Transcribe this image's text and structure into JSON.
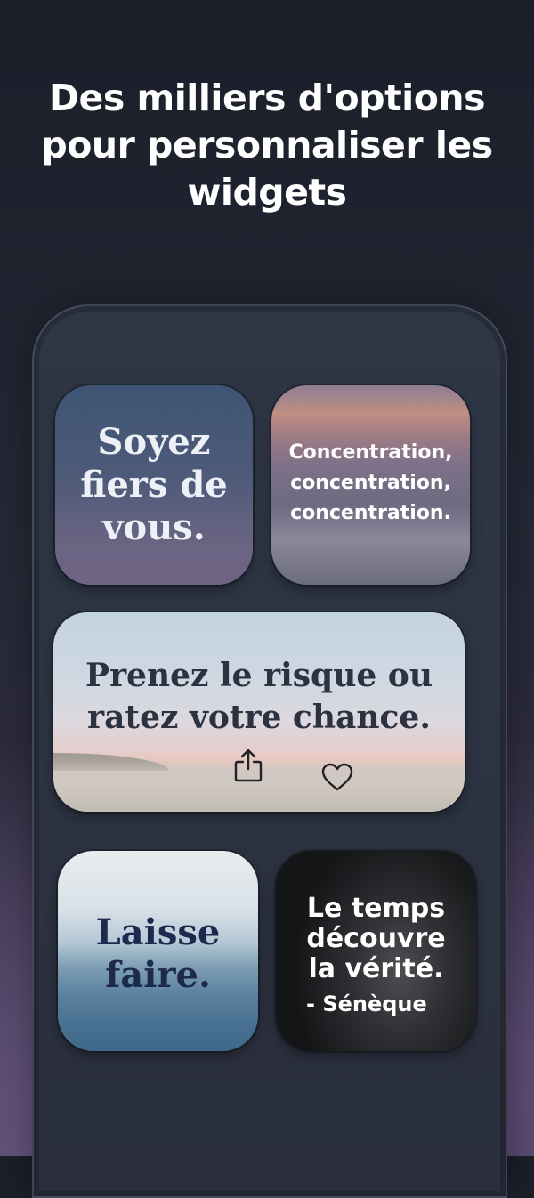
{
  "headline": {
    "line1": "Des milliers d'options",
    "line2": "pour personnaliser les",
    "line3": "widgets"
  },
  "widgets": {
    "w1": {
      "lines": [
        "Soyez",
        "fiers de",
        "vous."
      ]
    },
    "w2": {
      "lines": [
        "Concentration,",
        "concentration,",
        "concentration."
      ]
    },
    "w3": {
      "lines": [
        "Prenez le risque ou",
        "ratez votre chance."
      ],
      "share_icon": "share-icon",
      "heart_icon": "heart-icon"
    },
    "w4": {
      "lines": [
        "Laisse",
        "faire."
      ]
    },
    "w5": {
      "lines": [
        "Le temps",
        "découvre",
        "la vérité."
      ],
      "author": "- Sénèque"
    }
  }
}
